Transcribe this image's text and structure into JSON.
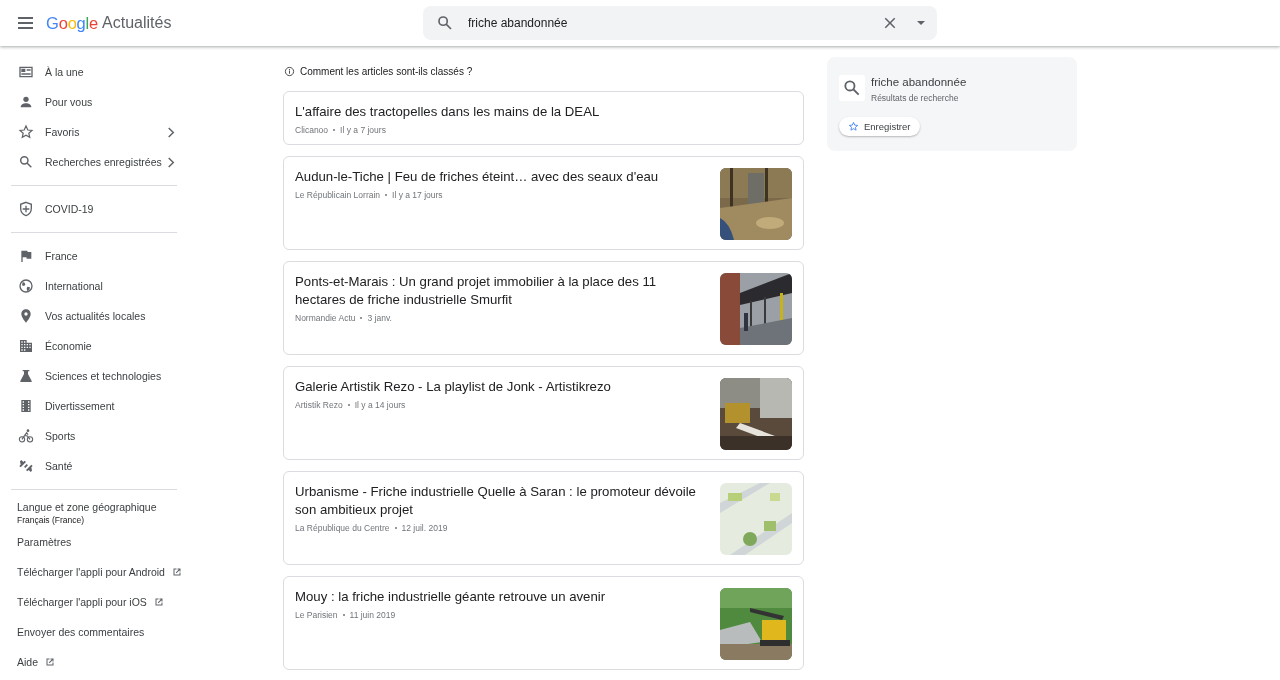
{
  "header": {
    "logo": "Google",
    "product": "Actualités",
    "search": {
      "value": "friche abandonnée"
    }
  },
  "sidebar": {
    "groups": [
      {
        "items": [
          {
            "label": "À la une",
            "expandable": false
          },
          {
            "label": "Pour vous",
            "expandable": false
          },
          {
            "label": "Favoris",
            "expandable": true
          },
          {
            "label": "Recherches enregistrées",
            "expandable": true
          }
        ]
      },
      {
        "items": [
          {
            "label": "COVID-19",
            "expandable": false
          }
        ]
      },
      {
        "items": [
          {
            "label": "France",
            "expandable": false
          },
          {
            "label": "International",
            "expandable": false
          },
          {
            "label": "Vos actualités locales",
            "expandable": false
          },
          {
            "label": "Économie",
            "expandable": false
          },
          {
            "label": "Sciences et technologies",
            "expandable": false
          },
          {
            "label": "Divertissement",
            "expandable": false
          },
          {
            "label": "Sports",
            "expandable": false
          },
          {
            "label": "Santé",
            "expandable": false
          }
        ]
      }
    ],
    "language": {
      "label": "Langue et zone géographique",
      "value": "Français (France)"
    },
    "links": [
      {
        "label": "Paramètres",
        "external": false
      },
      {
        "label": "Télécharger l'appli pour Android",
        "external": true
      },
      {
        "label": "Télécharger l'appli pour iOS",
        "external": true
      },
      {
        "label": "Envoyer des commentaires",
        "external": false
      },
      {
        "label": "Aide",
        "external": true
      }
    ]
  },
  "ranking_note": "Comment les articles sont-ils classés ?",
  "articles": [
    {
      "title": "L'affaire des tractopelles dans les mains de la DEAL",
      "source": "Clicanoo",
      "time": "Il y a 7 jours"
    },
    {
      "title": "Audun-le-Tiche | Feu de friches éteint… avec des seaux d'eau",
      "source": "Le Républicain Lorrain",
      "time": "Il y a 17 jours"
    },
    {
      "title": "Ponts-et-Marais : Un grand projet immobilier à la place des 11 hectares de friche industrielle Smurfit",
      "source": "Normandie Actu",
      "time": "3 janv."
    },
    {
      "title": "Galerie Artistik Rezo - La playlist de Jonk - Artistikrezo",
      "source": "Artistik Rezo",
      "time": "Il y a 14 jours"
    },
    {
      "title": "Urbanisme - Friche industrielle Quelle à Saran : le promoteur dévoile son ambitieux projet",
      "source": "La République du Centre",
      "time": "12 juil. 2019"
    },
    {
      "title": "Mouy : la friche industrielle géante retrouve un avenir",
      "source": "Le Parisien",
      "time": "11 juin 2019"
    }
  ],
  "search_panel": {
    "query": "friche abandonnée",
    "subtitle": "Résultats de recherche",
    "save_button": "Enregistrer"
  }
}
